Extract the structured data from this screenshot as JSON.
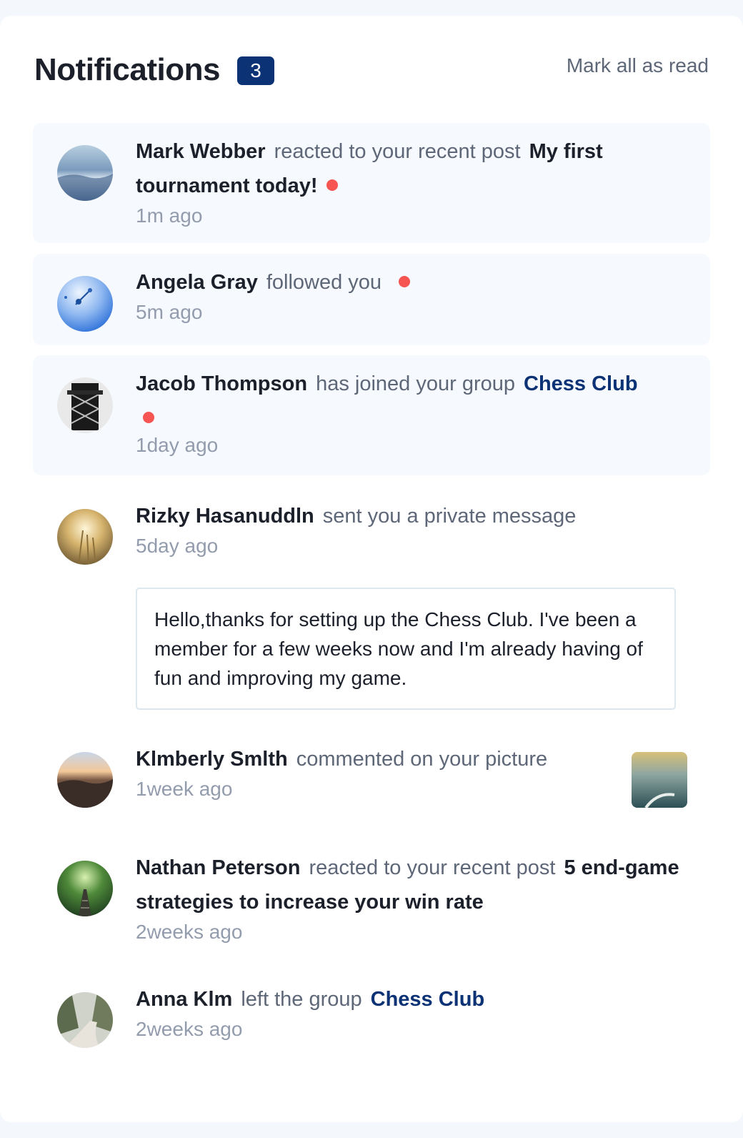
{
  "header": {
    "title": "Notifications",
    "count": "3",
    "mark_all": "Mark all as read"
  },
  "notifications": [
    {
      "name": "Mark Webber",
      "action": "reacted to your recent post",
      "post": "My first tournament today!",
      "unread": true,
      "time": "1m ago",
      "avatar_icon": "avatar-photo-sky"
    },
    {
      "name": "Angela Gray",
      "action": "followed you",
      "unread": true,
      "time": "5m ago",
      "avatar_icon": "avatar-photo-blue"
    },
    {
      "name": "Jacob Thompson",
      "action": "has joined your group",
      "group": "Chess Club",
      "unread": true,
      "time": "1day ago",
      "avatar_icon": "avatar-photo-tower"
    },
    {
      "name": "Rizky Hasanuddln",
      "action": "sent you a private message",
      "unread": false,
      "time": "5day ago",
      "message": "Hello,thanks for setting up the Chess Club. I've been a member for a few weeks now and I'm already having of fun and improving my game.",
      "avatar_icon": "avatar-photo-field"
    },
    {
      "name": "Klmberly Smlth",
      "action": "commented on your picture",
      "unread": false,
      "time": "1week ago",
      "avatar_icon": "avatar-photo-sunset",
      "picture_icon": "commented-picture-thumbnail"
    },
    {
      "name": "Nathan Peterson",
      "action": "reacted to your recent post",
      "post": "5 end-game strategies to increase your win rate",
      "unread": false,
      "time": "2weeks ago",
      "avatar_icon": "avatar-photo-forest"
    },
    {
      "name": "Anna Klm",
      "action": "left the group",
      "group": "Chess Club",
      "unread": false,
      "time": "2weeks ago",
      "avatar_icon": "avatar-photo-path"
    }
  ],
  "colors": {
    "accent": "#0b3275",
    "unread_dot": "#f65552",
    "unread_bg": "#f6f9fd",
    "muted": "#939cad"
  }
}
